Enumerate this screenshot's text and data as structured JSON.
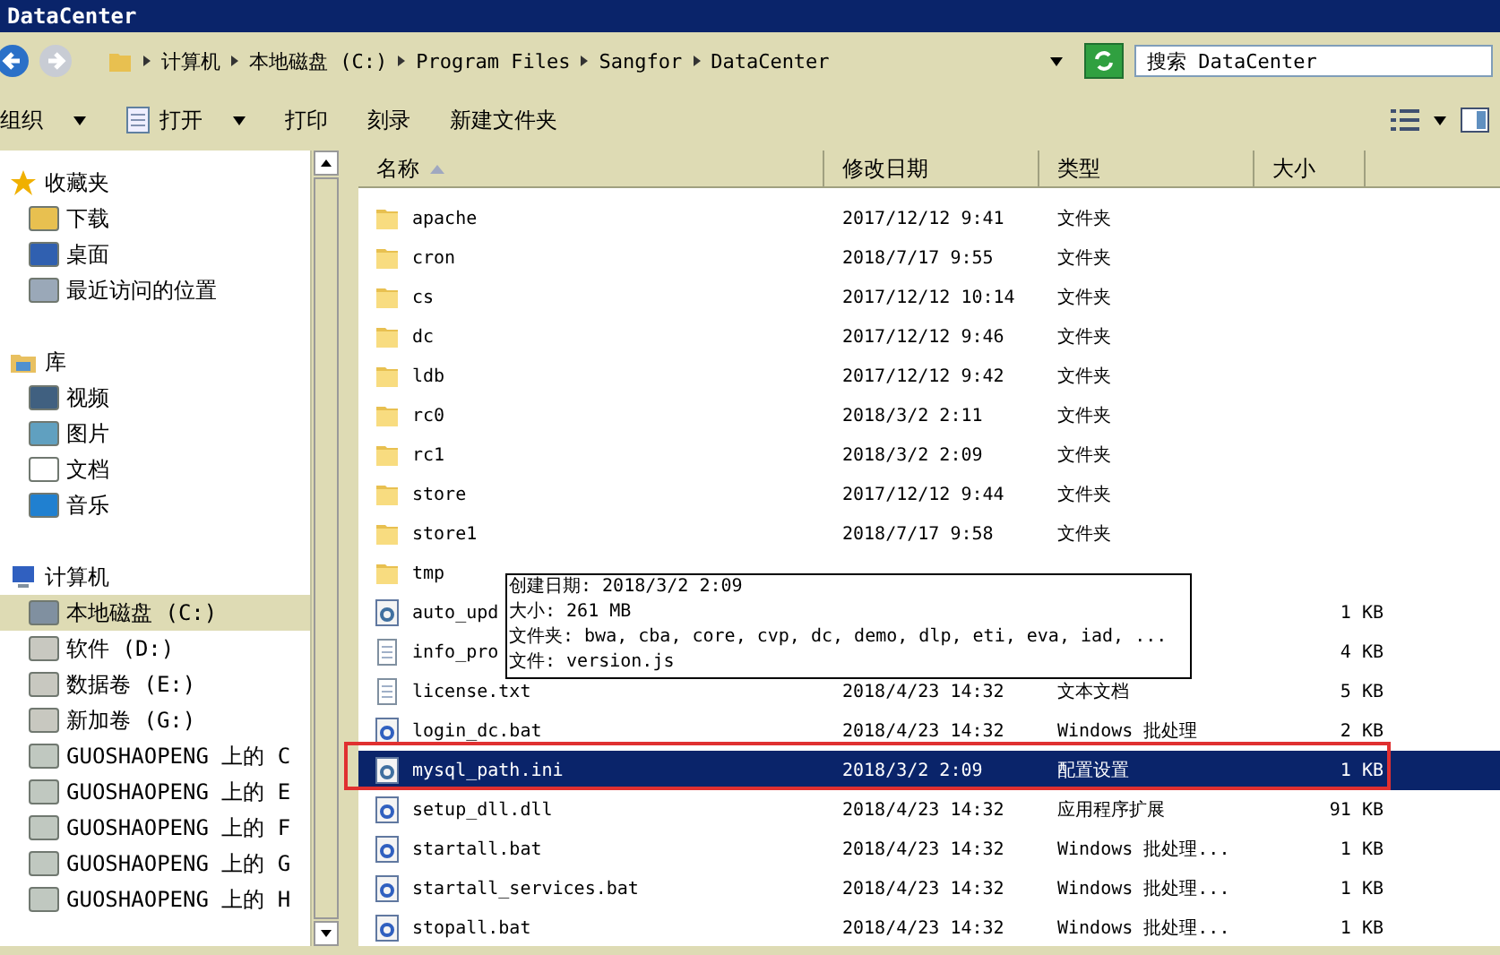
{
  "window": {
    "title": "DataCenter"
  },
  "address": {
    "crumbs": [
      "计算机",
      "本地磁盘 (C:)",
      "Program Files",
      "Sangfor",
      "DataCenter"
    ]
  },
  "search": {
    "placeholder": "搜索 DataCenter"
  },
  "toolbar": [
    {
      "label": "组织",
      "dropdown": true,
      "icon": false
    },
    {
      "label": "打开",
      "dropdown": true,
      "icon": true
    },
    {
      "label": "打印",
      "dropdown": false,
      "icon": false
    },
    {
      "label": "刻录",
      "dropdown": false,
      "icon": false
    },
    {
      "label": "新建文件夹",
      "dropdown": false,
      "icon": false
    }
  ],
  "sidebar": {
    "groups": [
      {
        "label": "收藏夹",
        "kind": "star",
        "children": [
          {
            "label": "下载",
            "kind": "download",
            "selected": false
          },
          {
            "label": "桌面",
            "kind": "desktop",
            "selected": false
          },
          {
            "label": "最近访问的位置",
            "kind": "recent",
            "selected": false
          }
        ]
      },
      {
        "label": "库",
        "kind": "library",
        "children": [
          {
            "label": "视频",
            "kind": "video",
            "selected": false
          },
          {
            "label": "图片",
            "kind": "image",
            "selected": false
          },
          {
            "label": "文档",
            "kind": "doc",
            "selected": false
          },
          {
            "label": "音乐",
            "kind": "music",
            "selected": false
          }
        ]
      },
      {
        "label": "计算机",
        "kind": "computer",
        "children": [
          {
            "label": "本地磁盘 (C:)",
            "kind": "sysdrive",
            "selected": true
          },
          {
            "label": "软件 (D:)",
            "kind": "drive",
            "selected": false
          },
          {
            "label": "数据卷 (E:)",
            "kind": "drive",
            "selected": false
          },
          {
            "label": "新加卷 (G:)",
            "kind": "drive",
            "selected": false
          },
          {
            "label": "GUOSHAOPENG 上的 C",
            "kind": "netdrive",
            "selected": false
          },
          {
            "label": "GUOSHAOPENG 上的 E",
            "kind": "netdrive",
            "selected": false
          },
          {
            "label": "GUOSHAOPENG 上的 F",
            "kind": "netdrive",
            "selected": false
          },
          {
            "label": "GUOSHAOPENG 上的 G",
            "kind": "netdrive",
            "selected": false
          },
          {
            "label": "GUOSHAOPENG 上的 H",
            "kind": "netdrive",
            "selected": false
          }
        ]
      }
    ]
  },
  "table": {
    "columns": [
      "名称",
      "修改日期",
      "类型",
      "大小"
    ],
    "rows": [
      {
        "kind": "folder",
        "name": "apache",
        "date": "2017/12/12 9:41",
        "type": "文件夹",
        "selected": false
      },
      {
        "kind": "folder",
        "name": "cron",
        "date": "2018/7/17 9:55",
        "type": "文件夹",
        "selected": false
      },
      {
        "kind": "folder",
        "name": "cs",
        "date": "2017/12/12 10:14",
        "type": "文件夹",
        "selected": false
      },
      {
        "kind": "folder",
        "name": "dc",
        "date": "2017/12/12 9:46",
        "type": "文件夹",
        "selected": false
      },
      {
        "kind": "folder",
        "name": "ldb",
        "date": "2017/12/12 9:42",
        "type": "文件夹",
        "selected": false
      },
      {
        "kind": "folder",
        "name": "rc0",
        "date": "2018/3/2 2:11",
        "type": "文件夹",
        "selected": false
      },
      {
        "kind": "folder",
        "name": "rc1",
        "date": "2018/3/2 2:09",
        "type": "文件夹",
        "selected": false
      },
      {
        "kind": "folder",
        "name": "store",
        "date": "2017/12/12 9:44",
        "type": "文件夹",
        "selected": false
      },
      {
        "kind": "folder",
        "name": "store1",
        "date": "2018/7/17 9:58",
        "type": "文件夹",
        "selected": false
      },
      {
        "kind": "folder",
        "name": "tmp",
        "selected": false
      },
      {
        "kind": "config",
        "name": "auto_upd",
        "size": "1 KB",
        "selected": false
      },
      {
        "kind": "text",
        "name": "info_pro",
        "size": "4 KB",
        "selected": false
      },
      {
        "kind": "text",
        "name": "license.txt",
        "date": "2018/4/23 14:32",
        "type": "文本文档",
        "size": "5 KB",
        "selected": false
      },
      {
        "kind": "batch",
        "name": "login_dc.bat",
        "date": "2018/4/23 14:32",
        "type": "Windows 批处理",
        "size": "2 KB",
        "selected": false
      },
      {
        "kind": "config",
        "name": "mysql_path.ini",
        "date": "2018/3/2 2:09",
        "type": "配置设置",
        "size": "1 KB",
        "selected": true
      },
      {
        "kind": "dll",
        "name": "setup_dll.dll",
        "date": "2018/4/23 14:32",
        "type": "应用程序扩展",
        "size": "91 KB",
        "selected": false
      },
      {
        "kind": "batch",
        "name": "startall.bat",
        "date": "2018/4/23 14:32",
        "type": "Windows 批处理...",
        "size": "1 KB",
        "selected": false
      },
      {
        "kind": "batch",
        "name": "startall_services.bat",
        "date": "2018/4/23 14:32",
        "type": "Windows 批处理...",
        "size": "1 KB",
        "selected": false
      },
      {
        "kind": "batch",
        "name": "stopall.bat",
        "date": "2018/4/23 14:32",
        "type": "Windows 批处理...",
        "size": "1 KB",
        "selected": false
      }
    ]
  },
  "tooltip": {
    "lines": [
      "创建日期: 2018/3/2 2:09",
      "大小: 261 MB",
      "文件夹: bwa, cba, core, cvp, dc, demo, dlp, eti, eva, iad, ...",
      "文件: version.js"
    ]
  }
}
